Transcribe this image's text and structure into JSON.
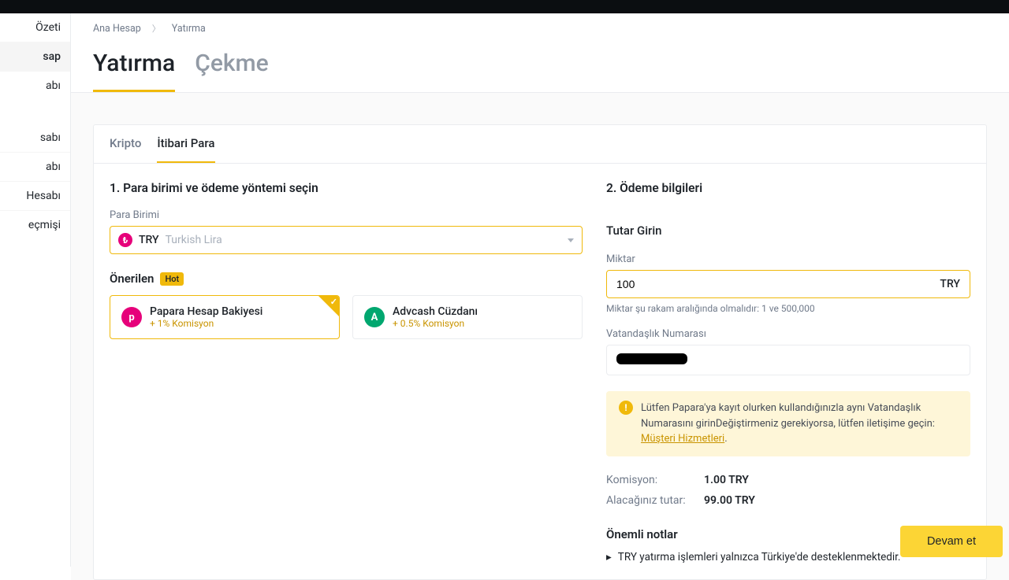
{
  "sidebar": {
    "items": [
      {
        "label": "Özeti"
      },
      {
        "label": "sap"
      },
      {
        "label": "abı"
      },
      {
        "label": "sabı"
      },
      {
        "label": "abı"
      },
      {
        "label": "Hesabı"
      },
      {
        "label": "eçmişi"
      }
    ]
  },
  "breadcrumb": {
    "items": [
      "Ana Hesap",
      "Yatırma"
    ]
  },
  "page_tabs": {
    "items": [
      {
        "label": "Yatırma",
        "active": true
      },
      {
        "label": "Çekme",
        "active": false
      }
    ]
  },
  "sub_tabs": {
    "items": [
      {
        "label": "Kripto",
        "active": false
      },
      {
        "label": "İtibari Para",
        "active": true
      }
    ]
  },
  "step1": {
    "title": "1. Para birimi ve ödeme yöntemi seçin",
    "currency_label": "Para Birimi",
    "currency_code": "TRY",
    "currency_name": "Turkish Lira",
    "recommend_label": "Önerilen",
    "hot_label": "Hot",
    "methods": [
      {
        "name": "Papara Hesap Bakiyesi",
        "fee": "+ 1% Komisyon",
        "icon_letter": "p",
        "icon_class": "papara",
        "selected": true
      },
      {
        "name": "Advcash Cüzdanı",
        "fee": "+ 0.5% Komisyon",
        "icon_letter": "A",
        "icon_class": "advcash",
        "selected": false
      }
    ]
  },
  "step2": {
    "title": "2. Ödeme bilgileri",
    "amount_heading": "Tutar Girin",
    "amount_label": "Miktar",
    "amount_value": "100",
    "amount_suffix": "TRY",
    "amount_hint": "Miktar şu rakam aralığında olmalıdır: 1 ve 500,000",
    "citizen_label": "Vatandaşlık Numarası",
    "notice_text": "Lütfen Papara'ya kayıt olurken kullandığınızla aynı Vatandaşlık Numarasını girinDeğiştirmeniz gerekiyorsa, lütfen iletişime geçin: ",
    "notice_link": "Müşteri Hizmetleri",
    "fee_label": "Komisyon:",
    "fee_value": "1.00 TRY",
    "receive_label": "Alacağınız tutar:",
    "receive_value": "99.00 TRY",
    "notes_title": "Önemli notlar",
    "notes": [
      "TRY yatırma işlemleri yalnızca Türkiye'de desteklenmektedir."
    ]
  },
  "continue_label": "Devam et",
  "colors": {
    "accent": "#f0b90b",
    "pink": "#e6007a",
    "green": "#00a76f"
  }
}
